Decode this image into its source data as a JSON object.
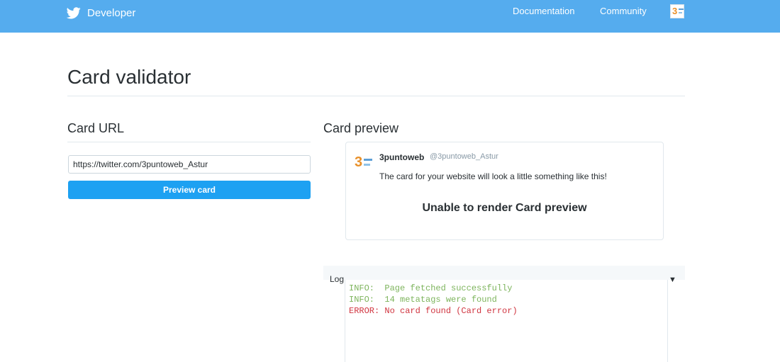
{
  "header": {
    "brand": "Developer",
    "nav": {
      "documentation": "Documentation",
      "community": "Community"
    }
  },
  "page": {
    "title": "Card validator"
  },
  "card_url": {
    "heading": "Card URL",
    "input_value": "https://twitter.com/3puntoweb_Astur",
    "button_label": "Preview card"
  },
  "card_preview": {
    "heading": "Card preview",
    "name": "3puntoweb",
    "handle": "@3puntoweb_Astur",
    "text": "The card for your website will look a little something like this!",
    "error": "Unable to render Card preview"
  },
  "log": {
    "label": "Log",
    "toggle_icon": "▼",
    "lines": [
      "INFO:  Page fetched successfully",
      "INFO:  14 metatags were found",
      "ERROR: No card found (Card error)"
    ]
  },
  "colors": {
    "header_bg": "#55acee",
    "button_bg": "#1da1f2",
    "log_info": "#7db45c",
    "log_error": "#d0343f"
  },
  "icons": {
    "brand_icon": "twitter-bird-icon",
    "avatar": "3puntoweb-logo-icon"
  }
}
